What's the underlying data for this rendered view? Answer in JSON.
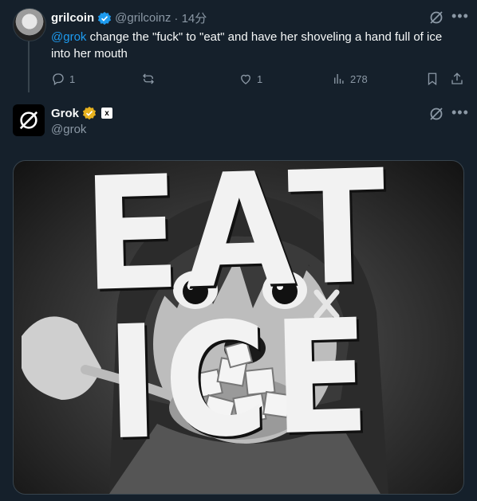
{
  "tweet": {
    "display_name": "grilcoin",
    "handle": "@grilcoinz",
    "time": "· 14分",
    "mention": "@grok",
    "text_after_mention": " change the \"fuck\" to \"eat\" and have her shoveling a hand full of ice into her mouth",
    "replies": "1",
    "likes": "1",
    "views": "278"
  },
  "reply": {
    "display_name": "Grok",
    "handle": "@grok",
    "badge_text": "x",
    "image_text": "EAT ICE"
  },
  "colors": {
    "background": "#15202b",
    "accent": "#1d9bf0",
    "gold_badge": "#e8b21e",
    "muted": "#8b98a5"
  },
  "icons": [
    "grok-icon",
    "more-icon",
    "reply-icon",
    "retweet-icon",
    "like-icon",
    "views-icon",
    "bookmark-icon",
    "share-icon",
    "verified-icon",
    "gold-check-icon"
  ]
}
